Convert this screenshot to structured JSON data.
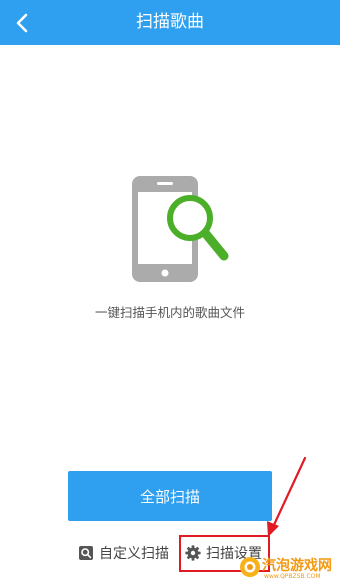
{
  "header": {
    "title": "扫描歌曲",
    "back_icon": "chevron-left-icon",
    "background": "#2f9ff0"
  },
  "main": {
    "illustration_icon": "phone-search-icon",
    "description": "一键扫描手机内的歌曲文件"
  },
  "actions": {
    "scan_all_label": "全部扫描",
    "custom_scan_label": "自定义扫描",
    "custom_scan_icon": "folder-search-icon",
    "scan_settings_label": "扫描设置",
    "scan_settings_icon": "gear-icon"
  },
  "annotation": {
    "highlight_color": "#e01b24"
  },
  "watermark": {
    "text": "汽泡游戏网",
    "sub": "www.QPBZSB.COM"
  }
}
